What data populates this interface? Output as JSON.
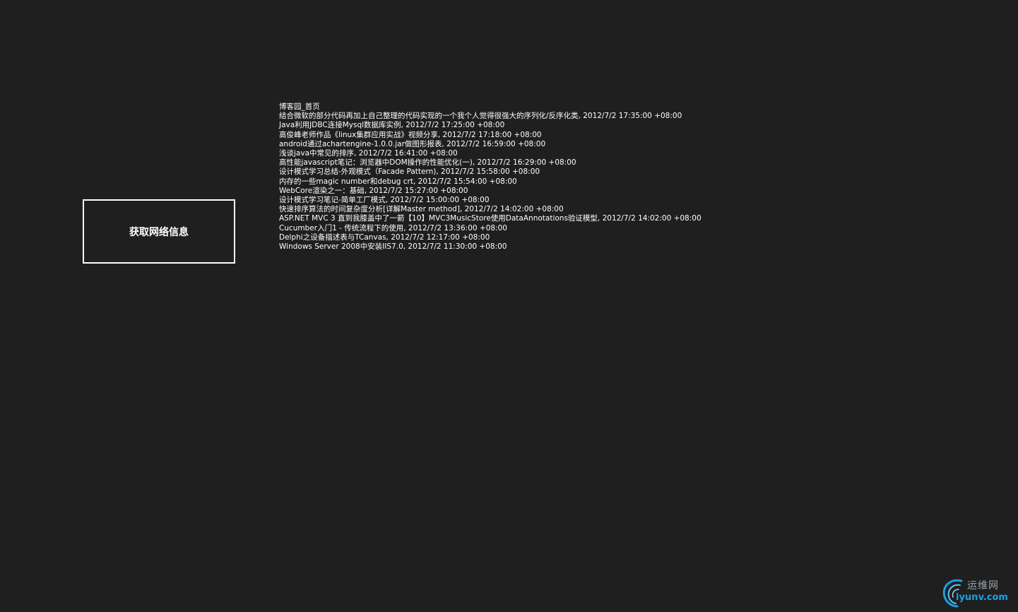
{
  "button": {
    "label": "获取网络信息"
  },
  "feed": {
    "title": "博客园_首页",
    "items": [
      "结合微软的部分代码再加上自己整理的代码实现的一个我个人觉得很强大的序列化/反序化类, 2012/7/2 17:35:00 +08:00",
      "Java利用JDBC连接Mysql数据库实例, 2012/7/2 17:25:00 +08:00",
      "高俊峰老师作品《linux集群应用实战》视频分享, 2012/7/2 17:18:00 +08:00",
      "android通过achartengine-1.0.0.jar做图形报表, 2012/7/2 16:59:00 +08:00",
      "浅谈java中常见的排序, 2012/7/2 16:41:00 +08:00",
      "高性能javascript笔记：浏览器中DOM操作的性能优化(一), 2012/7/2 16:29:00 +08:00",
      "设计模式学习总结-外观模式（Facade Pattern), 2012/7/2 15:58:00 +08:00",
      "内存的一些magic number和debug crt, 2012/7/2 15:54:00 +08:00",
      "WebCore渲染之一：基础, 2012/7/2 15:27:00 +08:00",
      "设计模式学习笔记-简单工厂模式, 2012/7/2 15:00:00 +08:00",
      "快速排序算法的时间复杂度分析[详解Master method], 2012/7/2 14:02:00 +08:00",
      "ASP.NET MVC 3 直到我膝盖中了一箭【10】MVC3MusicStore使用DataAnnotations验证模型, 2012/7/2 14:02:00 +08:00",
      "Cucumber入门1 - 传统流程下的使用, 2012/7/2 13:36:00 +08:00",
      "Delphi之设备描述表与TCanvas, 2012/7/2 12:17:00 +08:00",
      "Windows Server 2008中安装IIS7.0, 2012/7/2 11:30:00 +08:00"
    ]
  },
  "watermark": {
    "cn_text": "运维网",
    "en_text": "iyunv.com"
  },
  "colors": {
    "background": "#1f1f1f",
    "text": "#ffffff",
    "watermark_blue": "#1aa0e8",
    "watermark_gray": "#9aa4ad"
  },
  "icons": {
    "watermark_logo": "swirl-logo-icon"
  }
}
